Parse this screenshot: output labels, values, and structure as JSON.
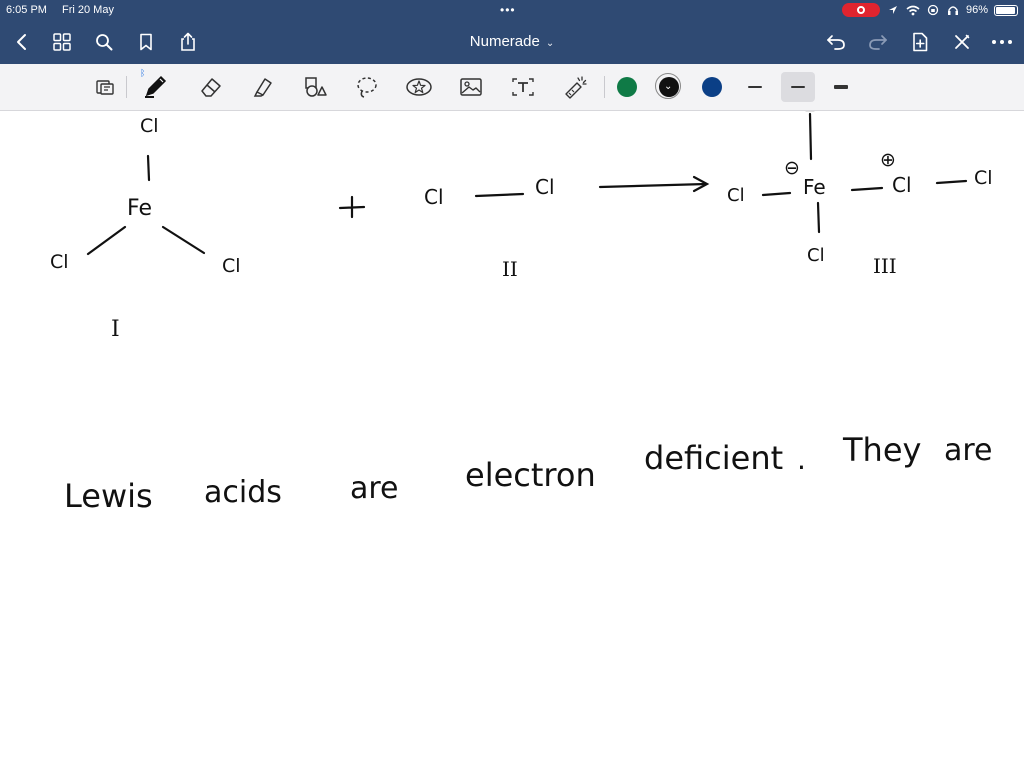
{
  "status_bar": {
    "time": "6:05 PM",
    "date": "Fri 20 May",
    "battery": "96%",
    "battery_level": 0.96,
    "icons": [
      "record-icon",
      "location-icon",
      "wifi-icon",
      "headphones-icon"
    ]
  },
  "nav": {
    "title": "Numerade",
    "icons": [
      "back-icon",
      "thumbnails-icon",
      "search-icon",
      "bookmark-icon",
      "share-icon",
      "undo-icon",
      "redo-icon",
      "add-page-icon",
      "close-icon",
      "more-icon"
    ]
  },
  "toolbar": {
    "tools": [
      "page-view-icon",
      "pen-icon",
      "eraser-icon",
      "highlighter-icon",
      "shapes-icon",
      "lasso-icon",
      "elements-icon",
      "image-icon",
      "text-icon",
      "laser-pointer-icon"
    ],
    "selected_tool": "pen-icon",
    "colors": [
      {
        "name": "green",
        "hex": "#0f7a46"
      },
      {
        "name": "black",
        "hex": "#111111"
      },
      {
        "name": "blue",
        "hex": "#0b3f86"
      }
    ],
    "selected_color": "black",
    "thicknesses": [
      "thin",
      "medium",
      "thick"
    ],
    "selected_thickness": "medium"
  },
  "canvas": {
    "reaction": {
      "species_I": {
        "center": "Fe",
        "ligand_top": "Cl",
        "ligand_left": "Cl",
        "ligand_right": "Cl",
        "label": "I"
      },
      "plus": "+",
      "species_II": {
        "left": "Cl",
        "right": "Cl",
        "label": "II"
      },
      "species_III": {
        "left": "Cl",
        "center": "Fe",
        "bottom": "Cl",
        "middle": "Cl",
        "right": "Cl",
        "negative_charge": "⊖",
        "positive_charge": "⊕",
        "label": "III"
      }
    },
    "sentence": [
      "Lewis",
      "acids",
      "are",
      "electron",
      "deficient",
      ".",
      "They",
      "are"
    ]
  }
}
